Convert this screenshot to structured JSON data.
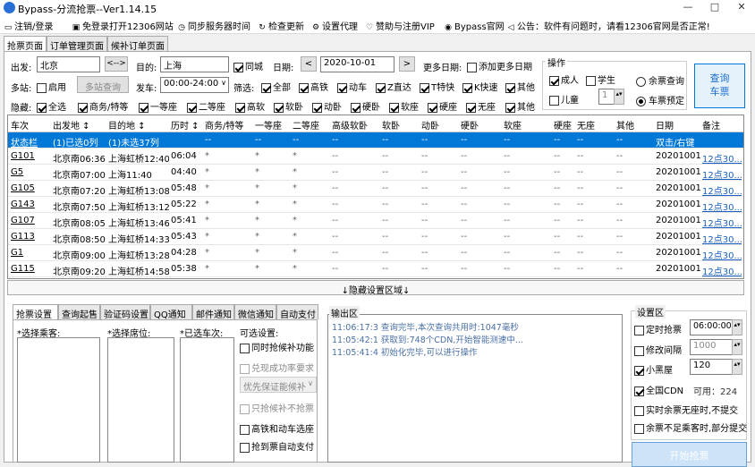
{
  "window": {
    "title": "Bypass-分流抢票--Ver1.14.15",
    "min": "—",
    "max": "□",
    "close": "✕"
  },
  "toolbar": {
    "logout": "注销/登录",
    "open_12306": "免登录打开12306网站",
    "sync_time": "同步服务器时间",
    "check_update": "检查更新",
    "proxy": "设置代理",
    "vip": "赞助与注册VIP",
    "site": "Bypass官网",
    "notice": "公告：软件有问题时，请看12306官网是否正常!"
  },
  "main_tabs": [
    "抢票页面",
    "订单管理页面",
    "候补订单页面"
  ],
  "query": {
    "from_label": "出发:",
    "from_value": "北京",
    "swap": "<-->",
    "to_label": "目的:",
    "to_value": "上海",
    "same_city": "同城",
    "date_label": "日期:",
    "date_value": "2020-10-01",
    "prev": "<",
    "next": ">",
    "more_dates_label": "更多日期:",
    "add_more_dates": "添加更多日期",
    "multi_station_label": "多站:",
    "enable": "启用",
    "multi_query": "多站查询",
    "depart_label": "发车:",
    "depart_value": "00:00-24:00",
    "depart_arrow": "∨",
    "filter_label": "筛选:",
    "filters": [
      "全部",
      "高铁",
      "动车",
      "Z直达",
      "T特快",
      "K快速",
      "其他"
    ],
    "hide_label": "隐藏:",
    "hide_items": [
      "全选",
      "商务/特等",
      "一等座",
      "二等座",
      "高软",
      "软卧",
      "动卧",
      "硬卧",
      "软座",
      "硬座",
      "无座",
      "其他"
    ]
  },
  "operation": {
    "label": "操作",
    "adult": "成人",
    "student": "学生",
    "child": "儿童",
    "child_count": "1",
    "remain_query": "余票查询",
    "ticket_reserve": "车票预定",
    "query_btn": "查询\n车票"
  },
  "grid": {
    "headers": [
      "车次",
      "出发地 ↕",
      "目的地 ↕",
      "历时 ↕",
      "商务/特等",
      "一等座",
      "二等座",
      "高级软卧",
      "软卧",
      "动卧",
      "硬卧",
      "软座",
      "硬座",
      "无座",
      "其他",
      "日期",
      "备注"
    ],
    "status_row": [
      "状态栏",
      "(1)已选0列",
      "(1)未选37列",
      "",
      "--",
      "--",
      "--",
      "--",
      "--",
      "--",
      "--",
      "--",
      "--",
      "--",
      "--",
      "双击/右键",
      ""
    ],
    "rows": [
      [
        "G101",
        "北京南06:36",
        "上海虹桥12:40",
        "06:04",
        "*",
        "*",
        "*",
        "--",
        "--",
        "--",
        "--",
        "--",
        "--",
        "--",
        "--",
        "20201001",
        "12点30..."
      ],
      [
        "G5",
        "北京南07:00",
        "上海11:40",
        "04:40",
        "*",
        "*",
        "*",
        "--",
        "--",
        "--",
        "--",
        "--",
        "--",
        "--",
        "--",
        "20201001",
        "12点30..."
      ],
      [
        "G105",
        "北京南07:20",
        "上海虹桥13:08",
        "05:48",
        "*",
        "*",
        "*",
        "--",
        "--",
        "--",
        "--",
        "--",
        "--",
        "--",
        "--",
        "20201001",
        "12点30..."
      ],
      [
        "G143",
        "北京南07:50",
        "上海虹桥13:12",
        "05:22",
        "*",
        "*",
        "*",
        "--",
        "--",
        "--",
        "--",
        "--",
        "--",
        "--",
        "--",
        "20201001",
        "12点30..."
      ],
      [
        "G107",
        "北京南08:05",
        "上海虹桥13:46",
        "05:41",
        "*",
        "*",
        "*",
        "--",
        "--",
        "--",
        "--",
        "--",
        "--",
        "--",
        "--",
        "20201001",
        "12点30..."
      ],
      [
        "G113",
        "北京南08:50",
        "上海虹桥14:33",
        "05:43",
        "*",
        "*",
        "*",
        "--",
        "--",
        "--",
        "--",
        "--",
        "--",
        "--",
        "--",
        "20201001",
        "12点30..."
      ],
      [
        "G1",
        "北京南09:00",
        "上海虹桥13:28",
        "04:28",
        "*",
        "*",
        "*",
        "--",
        "--",
        "--",
        "--",
        "--",
        "--",
        "--",
        "--",
        "20201001",
        "12点30..."
      ],
      [
        "G115",
        "北京南09:20",
        "上海虹桥14:58",
        "05:38",
        "*",
        "*",
        "*",
        "--",
        "--",
        "--",
        "--",
        "--",
        "--",
        "--",
        "--",
        "20201001",
        "12点30..."
      ]
    ]
  },
  "hidden_area": "↓隐藏设置区域↓",
  "bottom_tabs": [
    "抢票设置",
    "查询起售",
    "验证码设置",
    "QQ通知",
    "邮件通知",
    "微信通知",
    "自动支付"
  ],
  "settings": {
    "passengers": "*选择乘客:",
    "seats": "*选择席位:",
    "trains": "*已选车次:",
    "optional": "可选设置:",
    "opt1": "同时抢候补功能",
    "opt2": "兑现成功率要求",
    "opt3": "优先保证能候补",
    "opt4": "只抢候补不抢票",
    "opt5": "高铁和动车选座",
    "opt6": "抢到票自动支付"
  },
  "output": {
    "label": "输出区",
    "logs": [
      "11:06:17:3  查询完毕,本次查询共用时:1047毫秒",
      "11:05:42:1  获取到:748个CDN,开始智能测速中...",
      "11:05:41:4  初始化完毕,可以进行操作"
    ]
  },
  "settings_area": {
    "label": "设置区",
    "timed": "定时抢票",
    "timed_value": "06:00:00",
    "interval": "修改间隔",
    "interval_value": "1000",
    "blackroom": "小黑屋",
    "blackroom_value": "120",
    "cdn": "全国CDN",
    "cdn_avail": "可用：224",
    "realtime": "实时余票无座时,不提交",
    "partial": "余票不足乘客时,部分提交",
    "start": "开始抢票"
  }
}
